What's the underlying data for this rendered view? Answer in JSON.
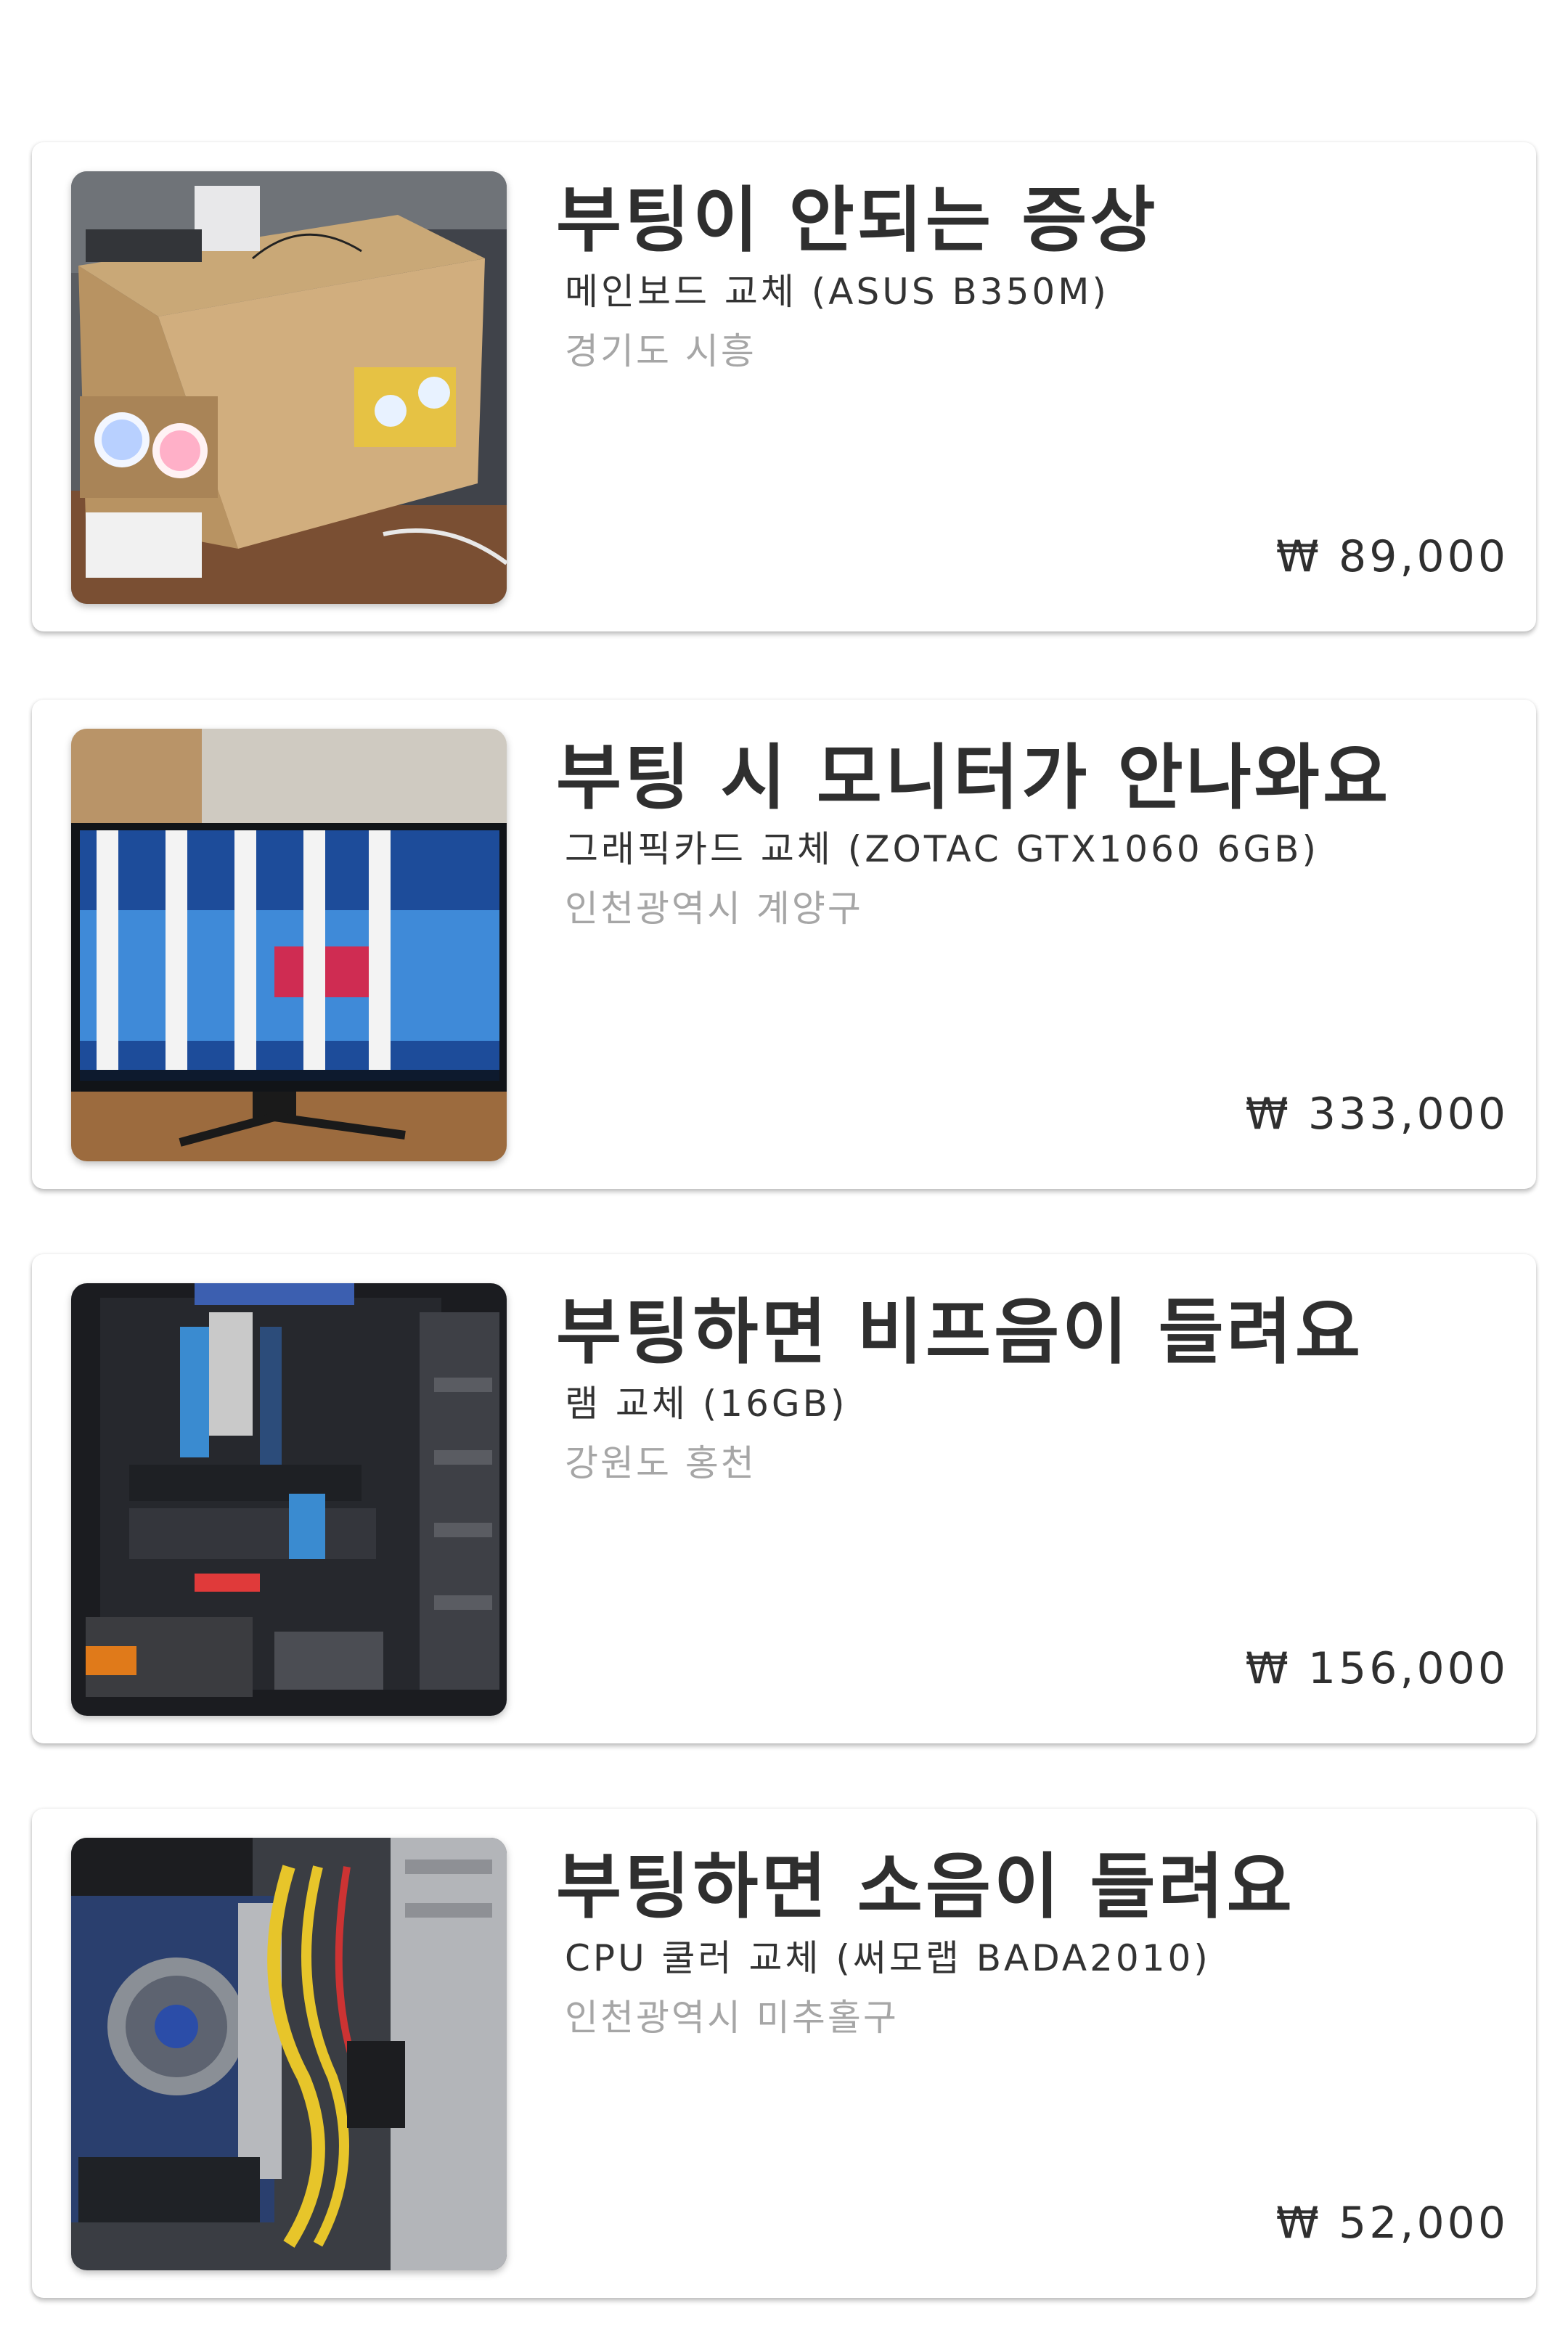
{
  "listings": [
    {
      "title": "부팅이 안되는 증상",
      "subtitle": "메인보드 교체 (ASUS B350M)",
      "location": "경기도 시흥",
      "price": "₩ 89,000",
      "image_desc": "cardboard-box-pc-case-photo"
    },
    {
      "title": "부팅 시 모니터가 안나와요",
      "subtitle": "그래픽카드 교체 (ZOTAC GTX1060 6GB)",
      "location": "인천광역시 계양구",
      "price": "₩ 333,000",
      "image_desc": "monitor-with-stripes-photo"
    },
    {
      "title": "부팅하면 비프음이 들려요",
      "subtitle": "램 교체 (16GB)",
      "location": "강원도 홍천",
      "price": "₩ 156,000",
      "image_desc": "open-pc-case-interior-photo"
    },
    {
      "title": "부팅하면 소음이 들려요",
      "subtitle": "CPU 쿨러 교체 (써모랩 BADA2010)",
      "location": "인천광역시 미추홀구",
      "price": "₩ 52,000",
      "image_desc": "pc-case-cpu-cooler-photo"
    }
  ],
  "colors": {
    "title": "#2f2f2f",
    "subtitle": "#333333",
    "location": "#a6a6a6",
    "card_bg": "#ffffff"
  }
}
